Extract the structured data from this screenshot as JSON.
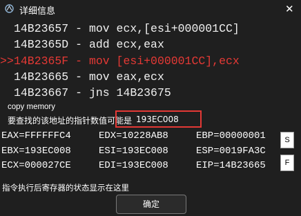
{
  "window": {
    "title": "详细信息",
    "close_glyph": "✕",
    "icon": "app-logo-icon"
  },
  "disassembly": [
    {
      "marker": "",
      "address": "14B23657",
      "instruction": "mov ecx,[esi+000001CC]",
      "current": false
    },
    {
      "marker": "",
      "address": "14B2365D",
      "instruction": "add ecx,eax",
      "current": false
    },
    {
      "marker": ">>",
      "address": "14B2365F",
      "instruction": "mov [esi+000001CC],ecx",
      "current": true
    },
    {
      "marker": "",
      "address": "14B23665",
      "instruction": "mov eax,ecx",
      "current": false
    },
    {
      "marker": "",
      "address": "14B23667",
      "instruction": "jns 14B23675",
      "current": false
    }
  ],
  "copy_memory_label": "copy memory",
  "pointer": {
    "label": "要查找的该地址的指针数值可能是",
    "value": "193EC008"
  },
  "registers": {
    "EAX": "FFFFFFC4",
    "EDX": "10228AB8",
    "EBP": "00000001",
    "EBX": "193EC008",
    "ESI": "193EC008",
    "ESP": "0019FA3C",
    "ECX": "000027CE",
    "EDI": "193EC008",
    "EIP": "14B23665"
  },
  "side_buttons": {
    "s": "S",
    "f": "F"
  },
  "status_text": "指令执行后寄存器的状态显示在这里",
  "ok_label": "确定",
  "colors": {
    "background": "#1f1f1f",
    "highlight": "#e53935",
    "text": "#ffffff"
  }
}
